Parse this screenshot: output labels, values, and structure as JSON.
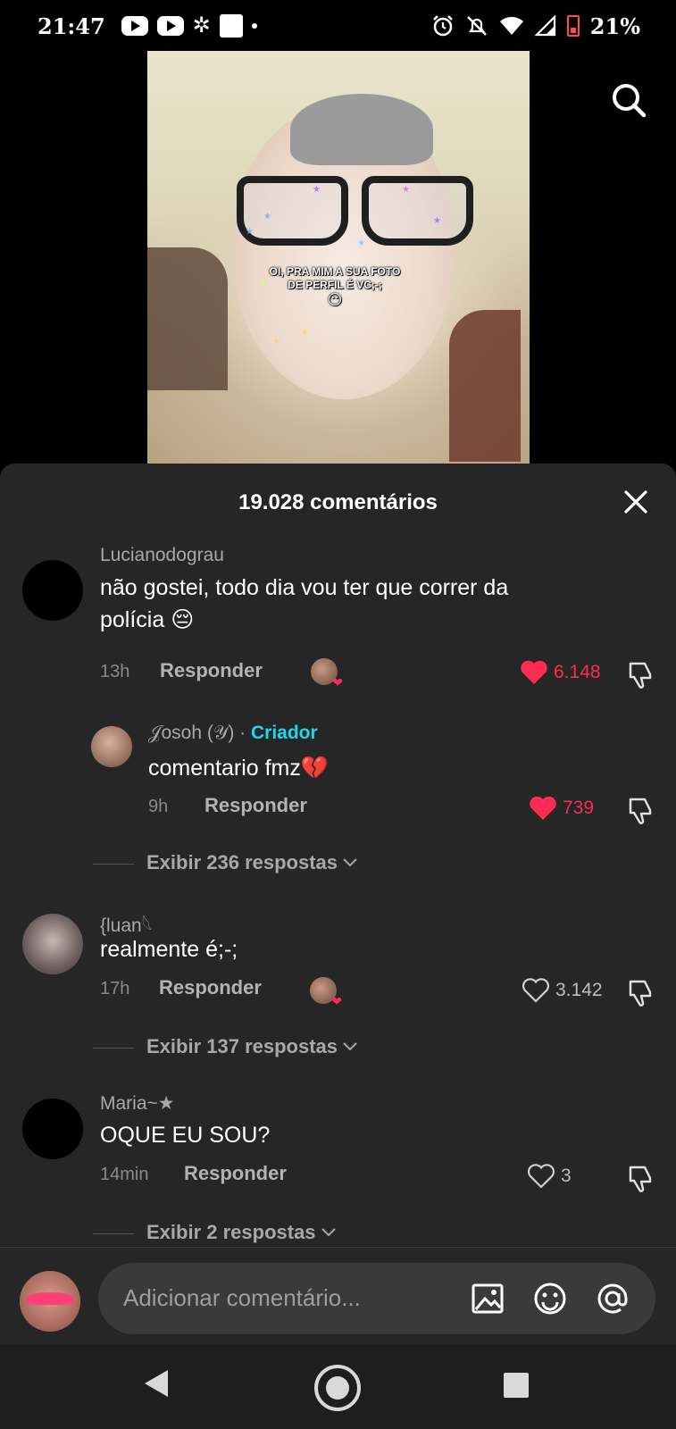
{
  "status_bar": {
    "time": "21:47",
    "battery": "21%",
    "icons": [
      "youtube-icon",
      "youtube-icon",
      "pinwheel-icon",
      "square-app-icon",
      "dot-icon",
      "alarm-icon",
      "mute-icon",
      "wifi-icon",
      "signal-icon",
      "battery-icon"
    ]
  },
  "video": {
    "caption_line1": "OI, PRA MIM A SUA FOTO",
    "caption_line2": "DE PERFIL É VC;-;",
    "caption_emoji": "😶"
  },
  "comments_sheet": {
    "title": "19.028 comentários",
    "comments": [
      {
        "username": "Lucianodograu",
        "text_line1": "não gostei, todo dia vou ter que correr da",
        "text_line2": "polícia 😔",
        "time": "13h",
        "reply_label": "Responder",
        "likes": "6.148",
        "liked": true,
        "accent_color": "#fe2c55"
      },
      {
        "username": "𝒥osoh (𝒴)",
        "separator": "·",
        "creator_label": "Criador",
        "text": "comentario fmz💔",
        "time": "9h",
        "reply_label": "Responder",
        "likes": "739",
        "liked": true
      },
      {
        "view_replies": "Exibir 236 respostas"
      },
      {
        "username": "{luan𓆩",
        "text": "realmente é;-;",
        "time": "17h",
        "reply_label": "Responder",
        "likes": "3.142",
        "liked": false
      },
      {
        "view_replies": "Exibir 137 respostas"
      },
      {
        "username": "Maria~★",
        "text": "OQUE EU SOU?",
        "time": "14min",
        "reply_label": "Responder",
        "likes": "3",
        "liked": false
      },
      {
        "view_replies": "Exibir 2 respostas"
      }
    ]
  },
  "input": {
    "placeholder": "Adicionar comentário..."
  },
  "colors": {
    "accent_red": "#fe2c55",
    "creator_cyan": "#20d5ec",
    "sheet_bg": "#262626"
  }
}
